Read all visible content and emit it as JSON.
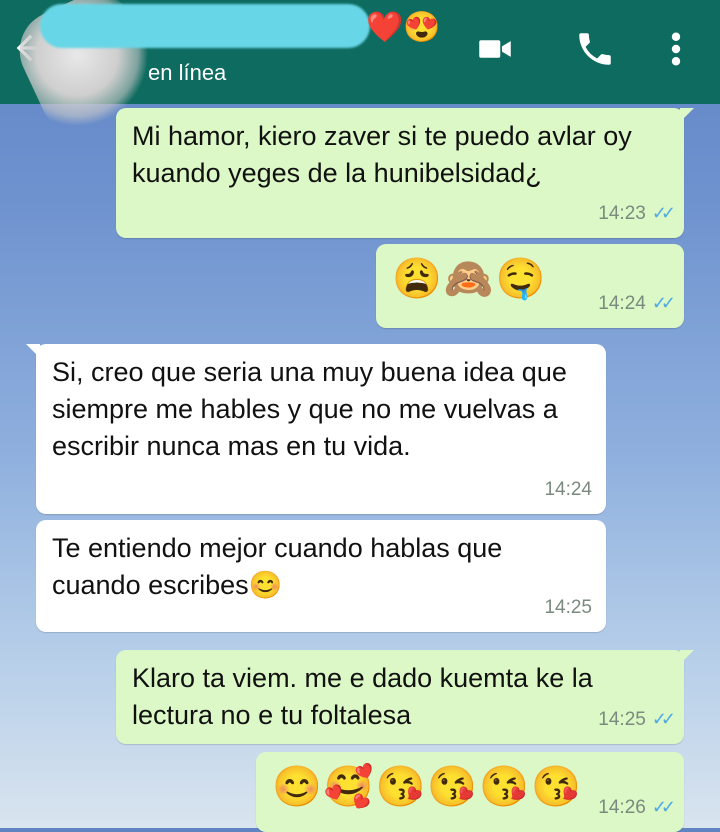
{
  "header": {
    "status": "en línea",
    "name_emojis": "❤️😍",
    "icons": [
      "back-arrow-icon",
      "video-call-icon",
      "phone-icon",
      "more-vert-icon"
    ]
  },
  "messages": [
    {
      "direction": "out",
      "text": "Mi hamor, kiero zaver si te puedo avlar oy kuando yeges de la hunibelsidad¿",
      "time": "14:23",
      "ticks": "✓✓"
    },
    {
      "direction": "out",
      "text": "😩🙈🤤",
      "time": "14:24",
      "ticks": "✓✓"
    },
    {
      "direction": "in",
      "text": "Si, creo que seria una muy buena idea que siempre me hables y que no me vuelvas a escribir nunca mas en tu vida.",
      "time": "14:24"
    },
    {
      "direction": "in",
      "text": "Te entiendo mejor cuando hablas que cuando escribes😊",
      "time": "14:25"
    },
    {
      "direction": "out",
      "text": "Klaro ta viem. me e dado kuemta ke la lectura no e tu foltalesa",
      "time": "14:25",
      "ticks": "✓✓"
    },
    {
      "direction": "out",
      "text": "😊🥰😘😘😘😘",
      "time": "14:26",
      "ticks": "✓✓"
    }
  ],
  "colors": {
    "header": "#0e6b5f",
    "outgoing": "#dcf8c6",
    "incoming": "#ffffff",
    "read_ticks": "#4fa9e7"
  }
}
